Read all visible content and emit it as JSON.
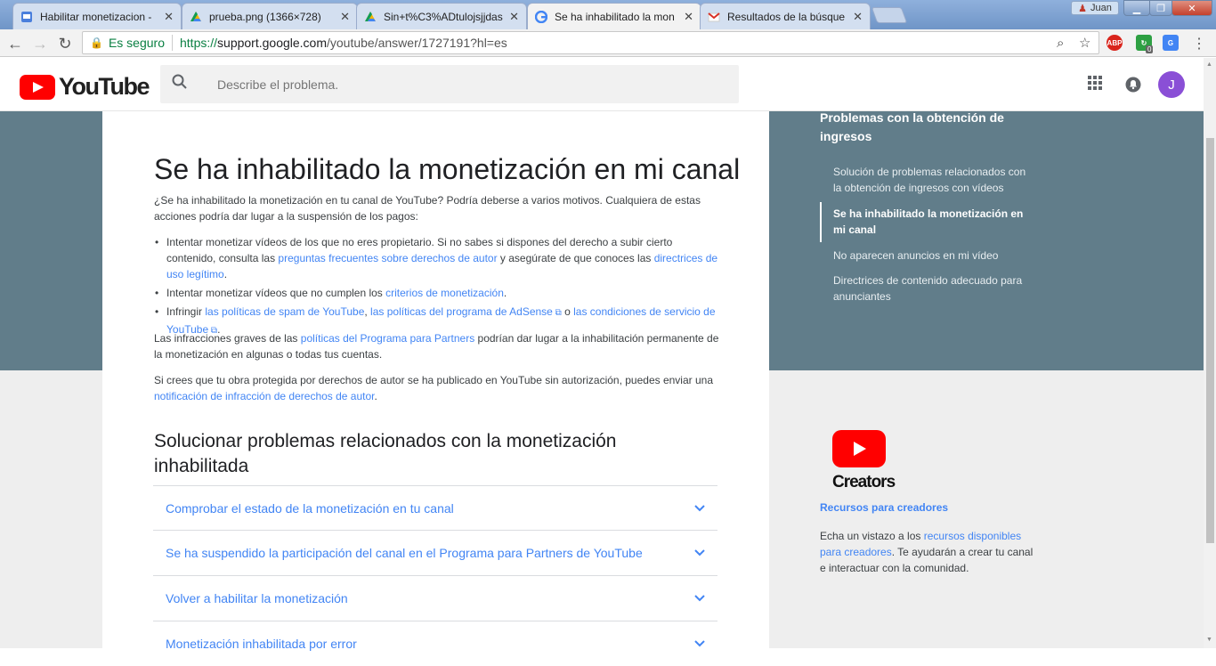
{
  "browser": {
    "tabs": [
      {
        "title": "Habilitar monetizacion -",
        "favicon": "docs-icon",
        "active": false
      },
      {
        "title": "prueba.png (1366×728)",
        "favicon": "drive-icon",
        "active": false
      },
      {
        "title": "Sin+t%C3%ADtulojsjjdas",
        "favicon": "drive-icon",
        "active": false
      },
      {
        "title": "Se ha inhabilitado la mon",
        "favicon": "google-icon",
        "active": true
      },
      {
        "title": "Resultados de la búsque",
        "favicon": "gmail-icon",
        "active": false
      }
    ],
    "user_label": "Juan",
    "security_label": "Es seguro",
    "url_scheme": "https://",
    "url_host": "support.google.com",
    "url_path": "/youtube/answer/1727191?hl=es",
    "extensions": [
      "ABP"
    ],
    "ext_badge": "0"
  },
  "header": {
    "logo_text": "YouTube",
    "search_placeholder": "Describe el problema.",
    "avatar_letter": "J"
  },
  "article": {
    "title": "Se ha inhabilitado la monetización en mi canal",
    "intro": "¿Se ha inhabilitado la monetización en tu canal de YouTube? Podría deberse a varios motivos. Cualquiera de estas acciones podría dar lugar a la suspensión de los pagos:",
    "b1_a": "Intentar monetizar vídeos de los que no eres propietario. Si no sabes si dispones del derecho a subir cierto contenido, consulta las ",
    "b1_link1": "preguntas frecuentes sobre derechos de autor",
    "b1_b": " y asegúrate de que conoces las ",
    "b1_link2": "directrices de uso legítimo",
    "b1_c": ".",
    "b2_a": "Intentar monetizar vídeos que no cumplen los ",
    "b2_link": "criterios de monetización",
    "b2_b": ".",
    "b3_a": "Infringir ",
    "b3_link1": "las políticas de spam de YouTube",
    "b3_sep1": ", ",
    "b3_link2": "las políticas del programa de AdSense",
    "b3_sep2": " o ",
    "b3_link3": "las condiciones de servicio de YouTube",
    "b3_end": ".",
    "p2_a": "Las infracciones graves de las ",
    "p2_link": "políticas del Programa para Partners",
    "p2_b": " podrían dar lugar a la inhabilitación permanente de la monetización en algunas o todas tus cuentas.",
    "p3_a": "Si crees que tu obra protegida por derechos de autor se ha publicado en YouTube sin autorización, puedes enviar una ",
    "p3_link": "notificación de infracción de derechos de autor",
    "p3_b": ".",
    "section_title": "Solucionar problemas relacionados con la monetización inhabilitada",
    "accordion": [
      "Comprobar el estado de la monetización en tu canal",
      "Se ha suspendido la participación del canal en el Programa para Partners de YouTube",
      "Volver a habilitar la monetización",
      "Monetización inhabilitada por error"
    ]
  },
  "sidebar": {
    "title": "Problemas con la obtención de ingresos",
    "items": [
      {
        "label": "Solución de problemas relacionados con la obtención de ingresos con vídeos",
        "active": false
      },
      {
        "label": "Se ha inhabilitado la monetización en mi canal",
        "active": true
      },
      {
        "label": "No aparecen anuncios en mi vídeo",
        "active": false
      },
      {
        "label": "Directrices de contenido adecuado para anunciantes",
        "active": false
      }
    ],
    "creators_word": "Creators",
    "resources_title": "Recursos para creadores",
    "resources_a": "Echa un vistazo a los ",
    "resources_link": "recursos disponibles para creadores",
    "resources_b": ". Te ayudarán a crear tu canal e interactuar con la comunidad."
  },
  "colors": {
    "band": "#617d8a",
    "link": "#4285f4",
    "youtube_red": "#ff0000"
  }
}
